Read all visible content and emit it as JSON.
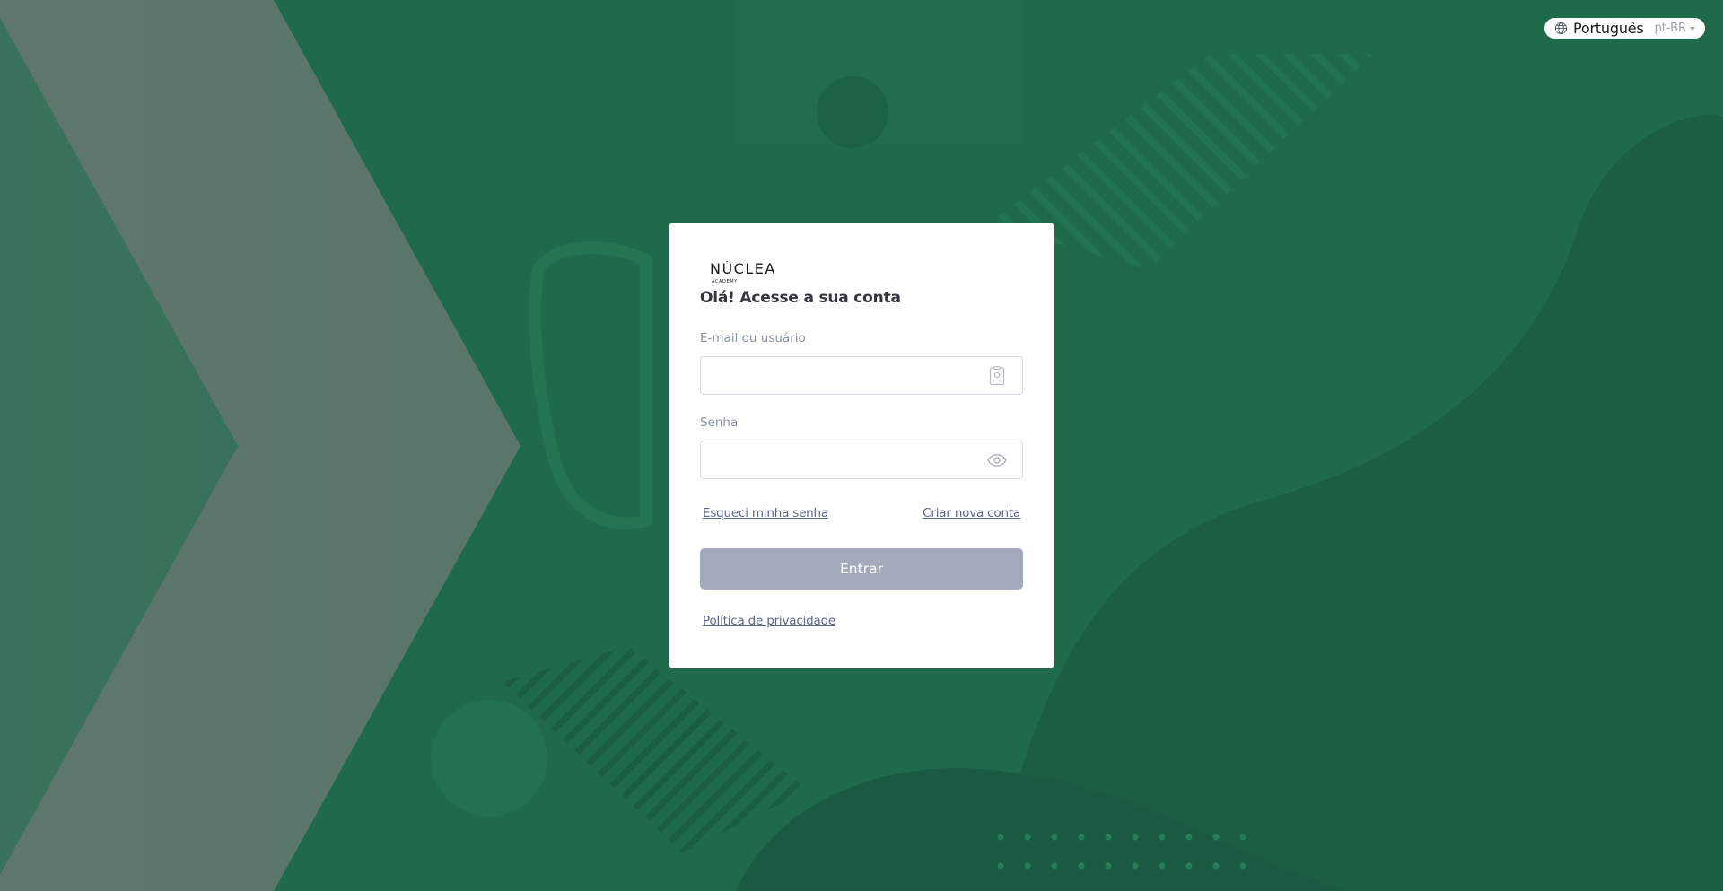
{
  "language": {
    "label": "Português",
    "code": "pt-BR"
  },
  "brand": {
    "logo_text": "NÚCLEA",
    "logo_subtext": "ACADEMY"
  },
  "login": {
    "greeting": "Olá! Acesse a sua conta",
    "email_label": "E-mail ou usuário",
    "email_value": "",
    "password_label": "Senha",
    "password_value": "",
    "forgot_password": "Esqueci minha senha",
    "create_account": "Criar nova conta",
    "submit_label": "Entrar",
    "privacy_policy": "Política de privacidade"
  },
  "colors": {
    "background": "#1f6a4b",
    "button_disabled": "#a3aabb",
    "link": "#5a6786"
  }
}
